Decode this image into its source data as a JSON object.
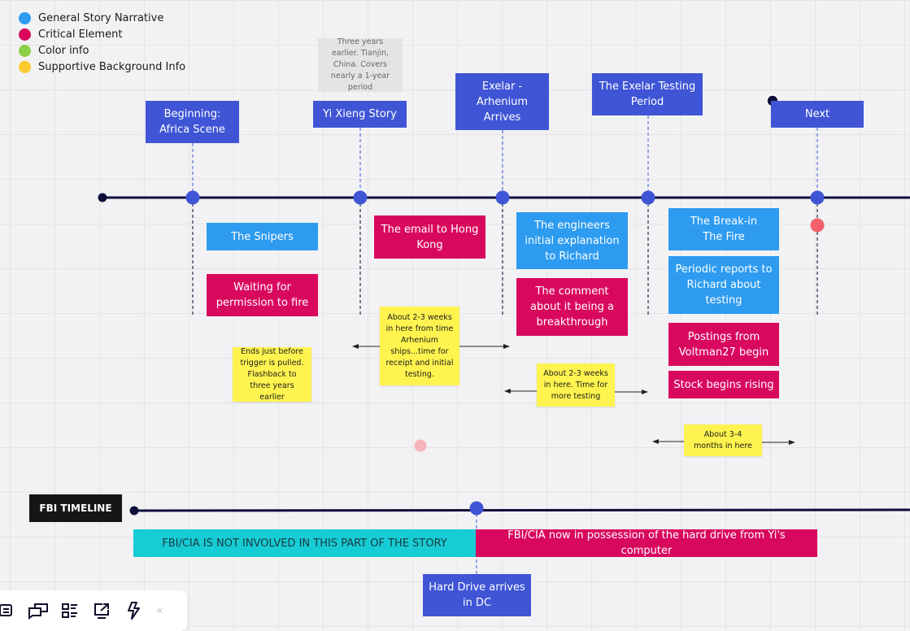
{
  "legend": [
    {
      "label": "General Story Narrative",
      "color": "#2d9bf0"
    },
    {
      "label": "Critical Element",
      "color": "#d9085f"
    },
    {
      "label": "Color info",
      "color": "#8cd14a"
    },
    {
      "label": "Supportive Background Info",
      "color": "#fccb2f"
    }
  ],
  "main_timeline": {
    "milestones": [
      {
        "label": "Beginning: Africa Scene"
      },
      {
        "label": "Yi Xieng Story",
        "note": "Three years earlier. Tianjin, China. Covers nearly a 1-year period"
      },
      {
        "label": "Exelar - Arhenium Arrives"
      },
      {
        "label": "The Exelar Testing Period"
      },
      {
        "label": "Next"
      }
    ],
    "events": {
      "snipers": "The Snipers",
      "waiting": "Waiting for permission to fire",
      "email": "The email to Hong Kong",
      "engineers": "The engineers initial explanation to Richard",
      "comment": "The comment about it being a breakthrough",
      "breakin": "The Break-in\nThe Fire",
      "periodic": "Periodic reports to Richard about testing",
      "postings": "Postings from Voltman27 begin",
      "stock": "Stock begins rising"
    },
    "stickies": {
      "ends": "Ends just before trigger is pulled. Flashback to three years earlier",
      "weeks1": "About 2-3 weeks in here from time Arhenium ships...time for receipt and initial testing.",
      "weeks2": "About 2-3 weeks in here. Time for more testing",
      "months": "About 3-4 months in here"
    }
  },
  "fbi_timeline": {
    "label": "FBI TIMELINE",
    "not_involved": "FBI/CIA IS NOT INVOLVED IN THIS PART OF THE STORY",
    "possession": "FBI/CIA now in possession of the hard drive from Yi's computer",
    "milestone": "Hard Drive arrives in DC"
  },
  "toolbar": {
    "icons": [
      "comment-icon",
      "chat-icon",
      "list-icon",
      "share-screen-icon",
      "lightning-icon"
    ],
    "collapse": "«"
  },
  "colors": {
    "milestone_blue": "#3f55d6",
    "narrative_blue": "#2d9bf0",
    "critical": "#d9085f",
    "sticky": "#fff44f",
    "timeline": "#0e0e3a",
    "fbi_cyan": "#17ccd4",
    "marker_red": "#f2606e"
  }
}
